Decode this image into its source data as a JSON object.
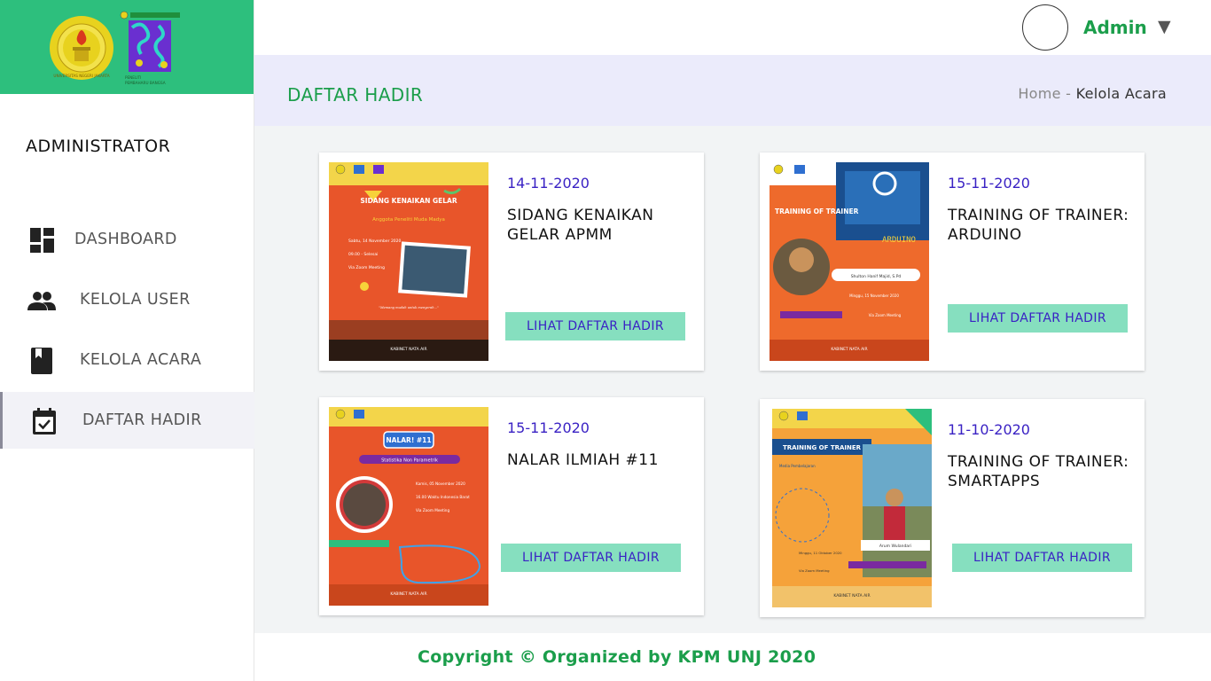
{
  "sidebar": {
    "logo_unj_text": "UNIVERSITAS NEGERI JAKARTA",
    "logo_kpm_text": "PENELITI PEMBAHARU BANGSA",
    "role_title": "ADMINISTRATOR",
    "items": [
      {
        "label": "DASHBOARD",
        "icon": "dashboard-icon"
      },
      {
        "label": "KELOLA USER",
        "icon": "users-icon"
      },
      {
        "label": "KELOLA ACARA",
        "icon": "book-icon"
      },
      {
        "label": "DAFTAR HADIR",
        "icon": "calendar-check-icon",
        "active": true
      }
    ]
  },
  "header": {
    "user_name": "Admin",
    "caret": "▼"
  },
  "page": {
    "title": "DAFTAR HADIR",
    "breadcrumb": {
      "home": "Home",
      "separator": " - ",
      "current": "Kelola Acara"
    }
  },
  "cards": [
    {
      "date": "14-11-2020",
      "title": "SIDANG KENAIKAN GELAR APMM",
      "button": "LIHAT DAFTAR HADIR",
      "poster": {
        "bg": "#e8552a",
        "headline": "SIDANG KENAIKAN GELAR",
        "sub": "Anggota Peneliti Muda Madya",
        "line1": "Sabtu, 14 November 2020",
        "line2": "09.00 - Selesai",
        "line3": "Via Zoom Meeting",
        "footer": "KABINET NATA AIR"
      }
    },
    {
      "date": "15-11-2020",
      "title": "TRAINING OF TRAINER: ARDUINO",
      "button": "LIHAT DAFTAR HADIR",
      "poster": {
        "bg": "#ee6a2c",
        "headline": "TRAINING OF TRAINER",
        "sub": "ARDUINO",
        "line1": "Shulton Hanif Majid, S.Pd",
        "line2": "Minggu, 15 November 2020",
        "line3": "Via Zoom Meeting",
        "footer": "KABINET NATA AIR"
      }
    },
    {
      "date": "15-11-2020",
      "title": "NALAR ILMIAH #11",
      "button": "LIHAT DAFTAR HADIR",
      "poster": {
        "bg": "#e8552a",
        "headline": "NALAR! #11",
        "sub": "Statistika Non Parametrik",
        "line1": "Kamis, 05 November 2020",
        "line2": "16.00 Waktu Indonesia Barat",
        "line3": "Via Zoom Meeting",
        "footer": "KABINET NATA AIR"
      }
    },
    {
      "date": "11-10-2020",
      "title": "TRAINING OF TRAINER: SMARTAPPS",
      "button": "LIHAT DAFTAR HADIR",
      "poster": {
        "bg": "#f5a23a",
        "headline": "TRAINING OF TRAINER",
        "sub": "Media Pembelajaran Menggunakan Smart Apps Creator",
        "line1": "Arum Wulandari",
        "line2": "Minggu, 11 Oktober 2020",
        "line3": "Via Zoom Meeting",
        "footer": "KABINET NATA AIR"
      }
    }
  ],
  "footer": {
    "copyright": "Copyright © Organized by KPM UNJ 2020"
  },
  "colors": {
    "brand_green": "#2dbf7d",
    "text_green": "#1b9e4b",
    "button_bg": "#86dfbf",
    "accent_blue": "#3a22c4",
    "band_bg": "#ebebfb"
  }
}
